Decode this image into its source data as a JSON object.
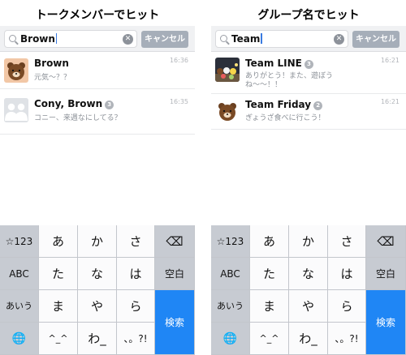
{
  "left": {
    "title": "トークメンバーでヒット",
    "search_value": "Brown",
    "clear_glyph": "✕",
    "cancel": "キャンセル",
    "results": [
      {
        "name": "Brown",
        "badge": "",
        "message": "元気〜？？",
        "time": "16:36",
        "avatar": "brown-bear"
      },
      {
        "name": "Cony, Brown",
        "badge": "3",
        "message": "コニー、来週なにしてる？",
        "time": "16:35",
        "avatar": "group-silhouettes"
      }
    ]
  },
  "right": {
    "title": "グループ名でヒット",
    "search_value": "Team",
    "clear_glyph": "✕",
    "cancel": "キャンセル",
    "results": [
      {
        "name": "Team LINE",
        "badge": "3",
        "message": "ありがとう！また、遊ぼうね〜〜！！",
        "time": "16:21",
        "avatar": "characters-photo"
      },
      {
        "name": "Team Friday",
        "badge": "2",
        "message": "ぎょうざ食べに行こう！",
        "time": "16:21",
        "avatar": "brown-bear"
      }
    ]
  },
  "keyboard": {
    "rows": [
      [
        "☆123",
        "あ",
        "か",
        "さ",
        "⌫"
      ],
      [
        "ABC",
        "た",
        "な",
        "は",
        "空白"
      ],
      [
        "あいう",
        "ま",
        "や",
        "ら",
        "検索"
      ],
      [
        "🌐",
        "^_^",
        "わ_",
        "、。?!"
      ]
    ],
    "colors": {
      "accent": "#1f86f5",
      "function_key": "#c7cbd2",
      "letter_key": "#fbfbfc"
    }
  }
}
